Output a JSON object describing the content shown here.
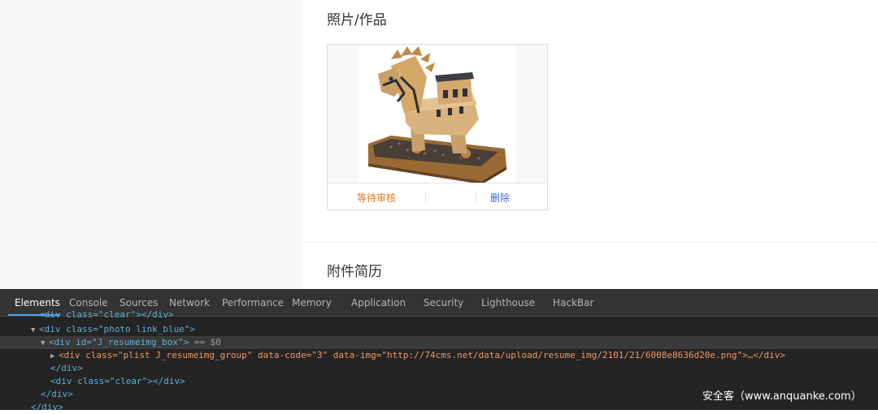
{
  "page": {
    "photo_section_title": "照片/作品",
    "attachment_section_title": "附件简历",
    "photo_card": {
      "status": "等待审核",
      "delete_label": "删除",
      "image_icon": "trojan-horse-image"
    }
  },
  "devtools": {
    "tabs": [
      "Elements",
      "Console",
      "Sources",
      "Network",
      "Performance",
      "Memory",
      "Application",
      "Security",
      "Lighthouse",
      "HackBar"
    ],
    "active_tab": "Elements",
    "dom_lines": {
      "l0": "<div class=\"clear\"></div>",
      "l1": "<div class=\"photo link_blue\">",
      "l2": "<div id=\"J_resumeimg_box\">",
      "l2_suffix": "== $0",
      "l3": "<div class=\"plist J_resumeimg_group\" data-code=\"3\" data-img=\"http://74cms.net/data/upload/resume_img/2101/21/6008e8636d20e.png\">…</div>",
      "l4": "</div>",
      "l5": "<div class=\"clear\"></div>",
      "l6": "</div>",
      "l7": "</div>"
    }
  },
  "watermark": "安全客（www.anquanke.com）",
  "colors": {
    "pending": "#e5741e",
    "delete_link": "#3f6bc9",
    "devtools_bg": "#242424",
    "devtools_tab_bar": "#333333",
    "devtools_accent": "#4f9ef2"
  }
}
